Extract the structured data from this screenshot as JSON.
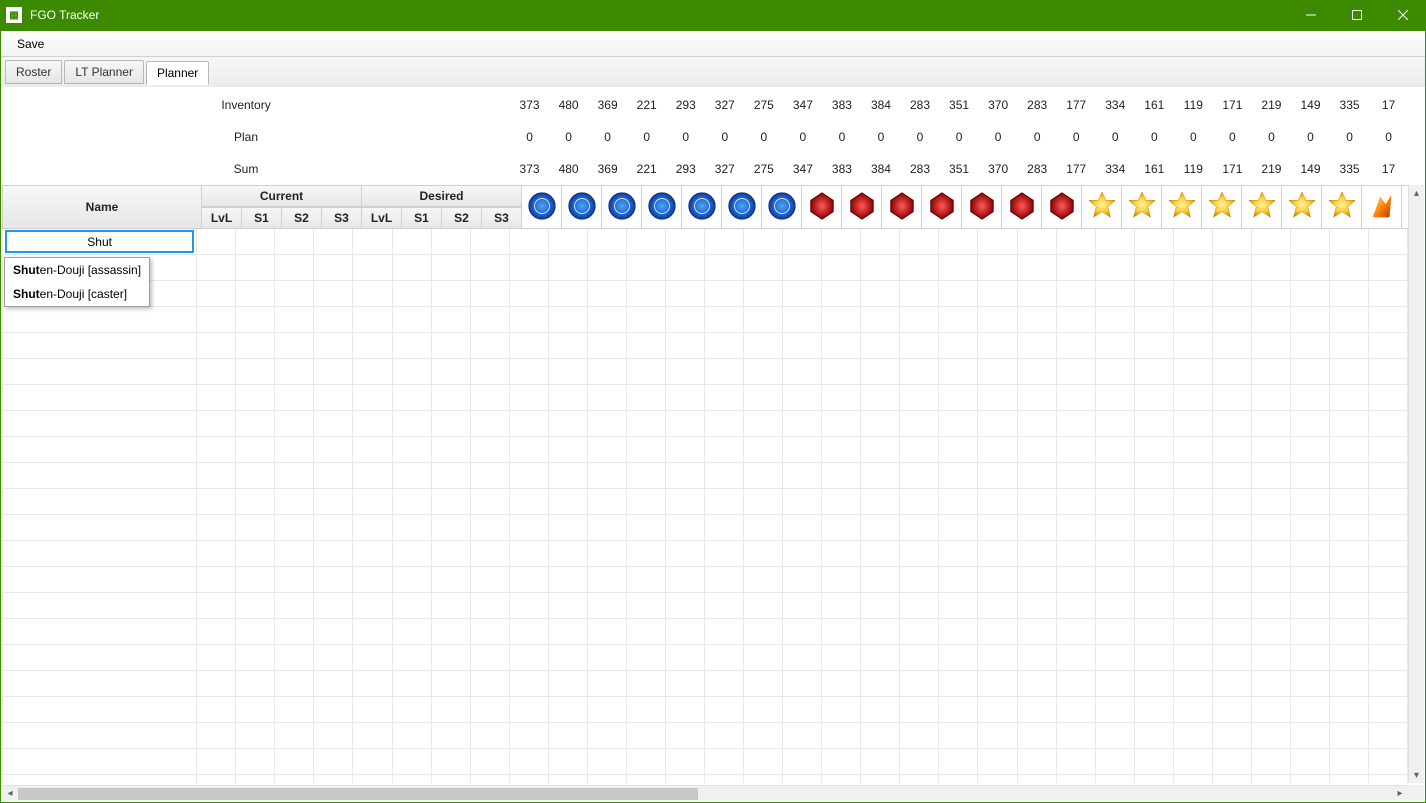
{
  "window": {
    "title": "FGO Tracker"
  },
  "menu": {
    "save": "Save"
  },
  "tabs": [
    {
      "id": "roster",
      "label": "Roster",
      "active": false
    },
    {
      "id": "ltplanner",
      "label": "LT Planner",
      "active": false
    },
    {
      "id": "planner",
      "label": "Planner",
      "active": true
    }
  ],
  "summary": {
    "rows": [
      {
        "label": "Inventory",
        "values": [
          373,
          480,
          369,
          221,
          293,
          327,
          275,
          347,
          383,
          384,
          283,
          351,
          370,
          283,
          177,
          334,
          161,
          119,
          171,
          219,
          149,
          335,
          "17"
        ]
      },
      {
        "label": "Plan",
        "values": [
          0,
          0,
          0,
          0,
          0,
          0,
          0,
          0,
          0,
          0,
          0,
          0,
          0,
          0,
          0,
          0,
          0,
          0,
          0,
          0,
          0,
          0,
          0
        ]
      },
      {
        "label": "Sum",
        "values": [
          373,
          480,
          369,
          221,
          293,
          327,
          275,
          347,
          383,
          384,
          283,
          351,
          370,
          283,
          177,
          334,
          161,
          119,
          171,
          219,
          149,
          335,
          "17"
        ]
      }
    ]
  },
  "headers": {
    "name": "Name",
    "current": "Current",
    "desired": "Desired",
    "subcols": [
      "LvL",
      "S1",
      "S2",
      "S3"
    ]
  },
  "materials": [
    {
      "id": "gem-saber",
      "group": "blue"
    },
    {
      "id": "gem-archer",
      "group": "blue"
    },
    {
      "id": "gem-lancer",
      "group": "blue"
    },
    {
      "id": "gem-rider",
      "group": "blue"
    },
    {
      "id": "gem-caster",
      "group": "blue"
    },
    {
      "id": "gem-assassin",
      "group": "blue"
    },
    {
      "id": "gem-berserker",
      "group": "blue"
    },
    {
      "id": "magic-saber",
      "group": "red"
    },
    {
      "id": "magic-archer",
      "group": "red"
    },
    {
      "id": "magic-lancer",
      "group": "red"
    },
    {
      "id": "magic-rider",
      "group": "red"
    },
    {
      "id": "magic-caster",
      "group": "red"
    },
    {
      "id": "magic-assassin",
      "group": "red"
    },
    {
      "id": "magic-berserker",
      "group": "red"
    },
    {
      "id": "secret-saber",
      "group": "gold"
    },
    {
      "id": "secret-archer",
      "group": "gold"
    },
    {
      "id": "secret-lancer",
      "group": "gold"
    },
    {
      "id": "secret-rider",
      "group": "gold"
    },
    {
      "id": "secret-caster",
      "group": "gold"
    },
    {
      "id": "secret-assassin",
      "group": "gold"
    },
    {
      "id": "secret-berserker",
      "group": "gold"
    },
    {
      "id": "ember",
      "group": "misc"
    },
    {
      "id": "piece",
      "group": "misc2"
    }
  ],
  "editing": {
    "value": "Shut",
    "suggestions": [
      {
        "match": "Shut",
        "rest": "en-Douji [assassin]"
      },
      {
        "match": "Shut",
        "rest": "en-Douji [caster]"
      }
    ]
  },
  "emptyRowCount": 22
}
